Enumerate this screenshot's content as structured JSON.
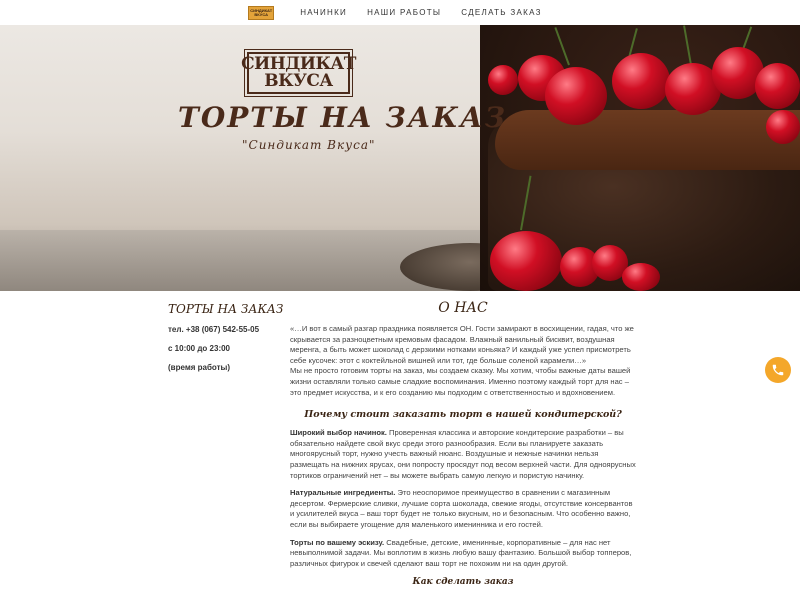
{
  "nav": {
    "logo_line1": "СИНДИКАТ",
    "logo_line2": "ВКУСА",
    "items": [
      "НАЧИНКИ",
      "НАШИ РАБОТЫ",
      "СДЕЛАТЬ ЗАКАЗ"
    ]
  },
  "hero": {
    "logo_line1": "СИНДИКАТ",
    "logo_line2": "ВКУСА",
    "title": "ТОРТЫ НА ЗАКАЗ",
    "subtitle": "\"Синдикат Вкуса\""
  },
  "sidebar": {
    "title": "ТОРТЫ НА ЗАКАЗ",
    "phone": "тел. +38 (067) 542-55-05",
    "hours": "с 10:00 до 23:00",
    "hours_note": "(время работы)"
  },
  "main": {
    "about_heading": "О НАС",
    "about_p1": "«…И вот в самый разгар праздника появляется ОН. Гости замирают в восхищении, гадая, что же скрывается за разноцветным кремовым фасадом. Влажный ванильный бисквит, воздушная меренга, а быть может шоколад с дерзкими нотками коньяка? И каждый уже успел присмотреть себе кусочек: этот с коктейльной вишней или тот, где больше соленой карамели…»",
    "about_p2": "Мы не просто готовим торты на заказ, мы создаем сказку. Мы хотим, чтобы важные даты вашей жизни оставляли только самые сладкие воспоминания. Именно поэтому каждый торт для нас – это предмет искусства, и к его созданию мы подходим с ответственностью и вдохновением.",
    "why_heading": "Почему стоит заказать торт в нашей кондитерской?",
    "reasons": [
      {
        "title": "Широкий выбор начинок.",
        "text": " Проверенная классика и авторские кондитерские разработки – вы обязательно найдете свой вкус среди этого разнообразия. Если вы планируете заказать многоярусный торт, нужно учесть важный нюанс. Воздушные и нежные начинки нельзя размещать на нижних ярусах, они попросту просядут под весом верхней части. Для одноярусных тортиков ограничений нет – вы можете выбрать самую легкую и пористую начинку."
      },
      {
        "title": "Натуральные ингредиенты.",
        "text": " Это неоспоримое преимущество в сравнении с магазинным десертом. Фермерские сливки, лучшие сорта шоколада, свежие ягоды, отсутствие консервантов и усилителей вкуса – ваш торт будет не только вкусным, но и безопасным. Что особенно важно, если вы выбираете угощение для маленького именинника и его гостей."
      },
      {
        "title": "Торты по вашему эскизу.",
        "text": " Свадебные, детские, именинные, корпоративные – для нас нет невыполнимой задачи. Мы воплотим в жизнь любую вашу фантазию. Большой выбор топперов, различных фигурок и свечей сделают ваш торт не похожим ни на один другой."
      }
    ],
    "how_heading": "Как сделать заказ"
  },
  "colors": {
    "accent": "#f4a72a",
    "brand_brown": "#4a2a1a"
  },
  "icons": {
    "phone": "phone-icon"
  }
}
